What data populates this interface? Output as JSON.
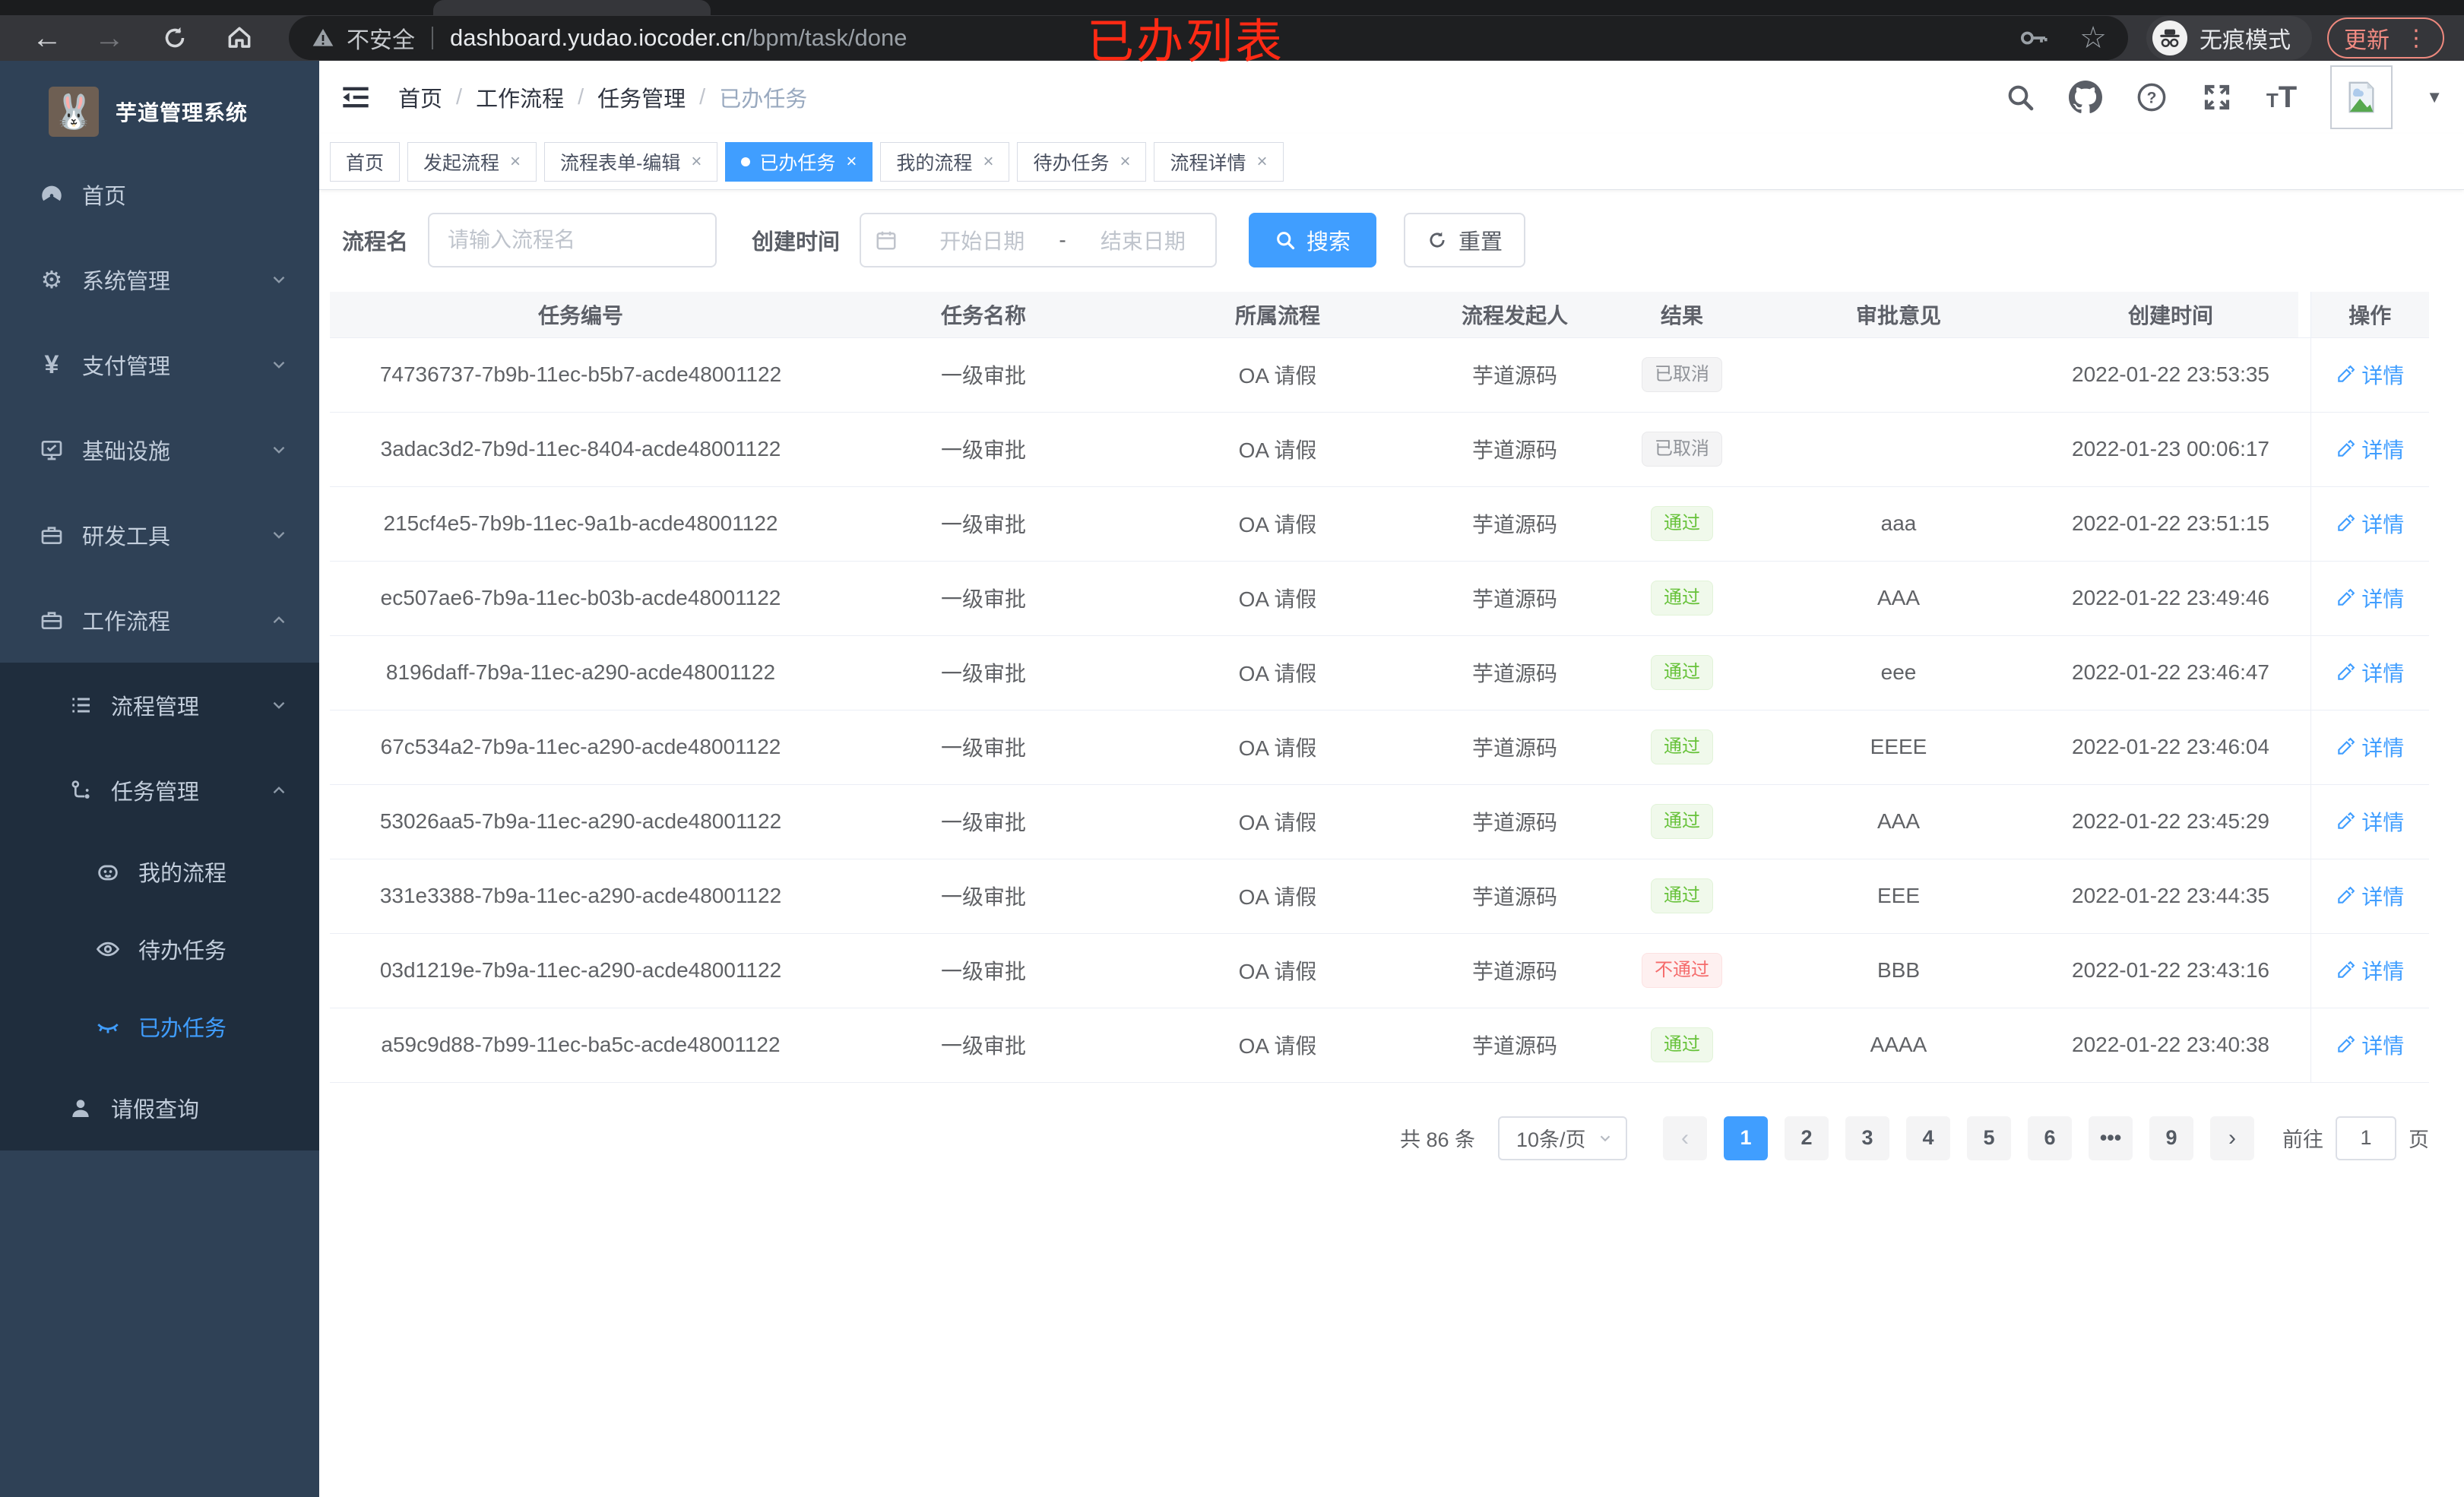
{
  "browser": {
    "security_label": "不安全",
    "url_domain": "dashboard.yudao.iocoder.cn",
    "url_path": "/bpm/task/done",
    "incognito_label": "无痕模式",
    "update_label": "更新",
    "menu_dots": "⋮"
  },
  "annotation": {
    "text": "已办列表",
    "color": "#fe2a14"
  },
  "sidebar": {
    "title": "芋道管理系统",
    "items": [
      {
        "label": "首页",
        "icon": "dashboard-icon",
        "level": 0
      },
      {
        "label": "系统管理",
        "icon": "gear-icon",
        "level": 0,
        "chevron": "down"
      },
      {
        "label": "支付管理",
        "icon": "yen-icon",
        "level": 0,
        "chevron": "down"
      },
      {
        "label": "基础设施",
        "icon": "infrastructure-icon",
        "level": 0,
        "chevron": "down"
      },
      {
        "label": "研发工具",
        "icon": "toolbox-icon",
        "level": 0,
        "chevron": "down"
      },
      {
        "label": "工作流程",
        "icon": "workflow-icon",
        "level": 0,
        "chevron": "up"
      },
      {
        "label": "流程管理",
        "icon": "process-list-icon",
        "level": 1,
        "chevron": "down",
        "dark": true
      },
      {
        "label": "任务管理",
        "icon": "task-branch-icon",
        "level": 1,
        "chevron": "up",
        "dark": true
      },
      {
        "label": "我的流程",
        "icon": "robot-icon",
        "level": 2,
        "dark": true
      },
      {
        "label": "待办任务",
        "icon": "eye-open-icon",
        "level": 2,
        "dark": true
      },
      {
        "label": "已办任务",
        "icon": "eye-closed-icon",
        "level": 2,
        "dark": true,
        "active": true
      },
      {
        "label": "请假查询",
        "icon": "person-icon",
        "level": 1,
        "dark": true
      }
    ]
  },
  "header": {
    "breadcrumb": [
      "首页",
      "工作流程",
      "任务管理",
      "已办任务"
    ]
  },
  "tabs": [
    {
      "label": "首页"
    },
    {
      "label": "发起流程",
      "closable": true
    },
    {
      "label": "流程表单-编辑",
      "closable": true
    },
    {
      "label": "已办任务",
      "closable": true,
      "active": true
    },
    {
      "label": "我的流程",
      "closable": true
    },
    {
      "label": "待办任务",
      "closable": true
    },
    {
      "label": "流程详情",
      "closable": true
    }
  ],
  "filters": {
    "name_label": "流程名",
    "name_placeholder": "请输入流程名",
    "date_label": "创建时间",
    "date_start_placeholder": "开始日期",
    "date_separator": "-",
    "date_end_placeholder": "结束日期",
    "search_label": "搜索",
    "reset_label": "重置"
  },
  "table": {
    "columns": [
      "任务编号",
      "任务名称",
      "所属流程",
      "流程发起人",
      "结果",
      "审批意见",
      "创建时间",
      "操作"
    ],
    "action_label": "详情",
    "rows": [
      {
        "id": "74736737-7b9b-11ec-b5b7-acde48001122",
        "name": "一级审批",
        "process": "OA 请假",
        "starter": "芋道源码",
        "result": "已取消",
        "result_type": "info",
        "comment": "",
        "created": "2022-01-22 23:53:35"
      },
      {
        "id": "3adac3d2-7b9d-11ec-8404-acde48001122",
        "name": "一级审批",
        "process": "OA 请假",
        "starter": "芋道源码",
        "result": "已取消",
        "result_type": "info",
        "comment": "",
        "created": "2022-01-23 00:06:17"
      },
      {
        "id": "215cf4e5-7b9b-11ec-9a1b-acde48001122",
        "name": "一级审批",
        "process": "OA 请假",
        "starter": "芋道源码",
        "result": "通过",
        "result_type": "success",
        "comment": "aaa",
        "created": "2022-01-22 23:51:15"
      },
      {
        "id": "ec507ae6-7b9a-11ec-b03b-acde48001122",
        "name": "一级审批",
        "process": "OA 请假",
        "starter": "芋道源码",
        "result": "通过",
        "result_type": "success",
        "comment": "AAA",
        "created": "2022-01-22 23:49:46"
      },
      {
        "id": "8196daff-7b9a-11ec-a290-acde48001122",
        "name": "一级审批",
        "process": "OA 请假",
        "starter": "芋道源码",
        "result": "通过",
        "result_type": "success",
        "comment": "eee",
        "created": "2022-01-22 23:46:47"
      },
      {
        "id": "67c534a2-7b9a-11ec-a290-acde48001122",
        "name": "一级审批",
        "process": "OA 请假",
        "starter": "芋道源码",
        "result": "通过",
        "result_type": "success",
        "comment": "EEEE",
        "created": "2022-01-22 23:46:04"
      },
      {
        "id": "53026aa5-7b9a-11ec-a290-acde48001122",
        "name": "一级审批",
        "process": "OA 请假",
        "starter": "芋道源码",
        "result": "通过",
        "result_type": "success",
        "comment": "AAA",
        "created": "2022-01-22 23:45:29"
      },
      {
        "id": "331e3388-7b9a-11ec-a290-acde48001122",
        "name": "一级审批",
        "process": "OA 请假",
        "starter": "芋道源码",
        "result": "通过",
        "result_type": "success",
        "comment": "EEE",
        "created": "2022-01-22 23:44:35"
      },
      {
        "id": "03d1219e-7b9a-11ec-a290-acde48001122",
        "name": "一级审批",
        "process": "OA 请假",
        "starter": "芋道源码",
        "result": "不通过",
        "result_type": "danger",
        "comment": "BBB",
        "created": "2022-01-22 23:43:16"
      },
      {
        "id": "a59c9d88-7b99-11ec-ba5c-acde48001122",
        "name": "一级审批",
        "process": "OA 请假",
        "starter": "芋道源码",
        "result": "通过",
        "result_type": "success",
        "comment": "AAAA",
        "created": "2022-01-22 23:40:38"
      }
    ]
  },
  "pagination": {
    "total_label": "共 86 条",
    "page_size": "10条/页",
    "pages": [
      "1",
      "2",
      "3",
      "4",
      "5",
      "6",
      "•••",
      "9"
    ],
    "active_page": "1",
    "prev": "‹",
    "next": "›",
    "goto_label": "前往",
    "goto_value": "1",
    "goto_suffix": "页"
  },
  "colors": {
    "accent": "#409eff",
    "success": "#67c23a",
    "danger": "#f56c6c",
    "info": "#909399",
    "sidebar_bg": "#2f4156",
    "sidebar_submenu_bg": "#1f2d3d"
  }
}
